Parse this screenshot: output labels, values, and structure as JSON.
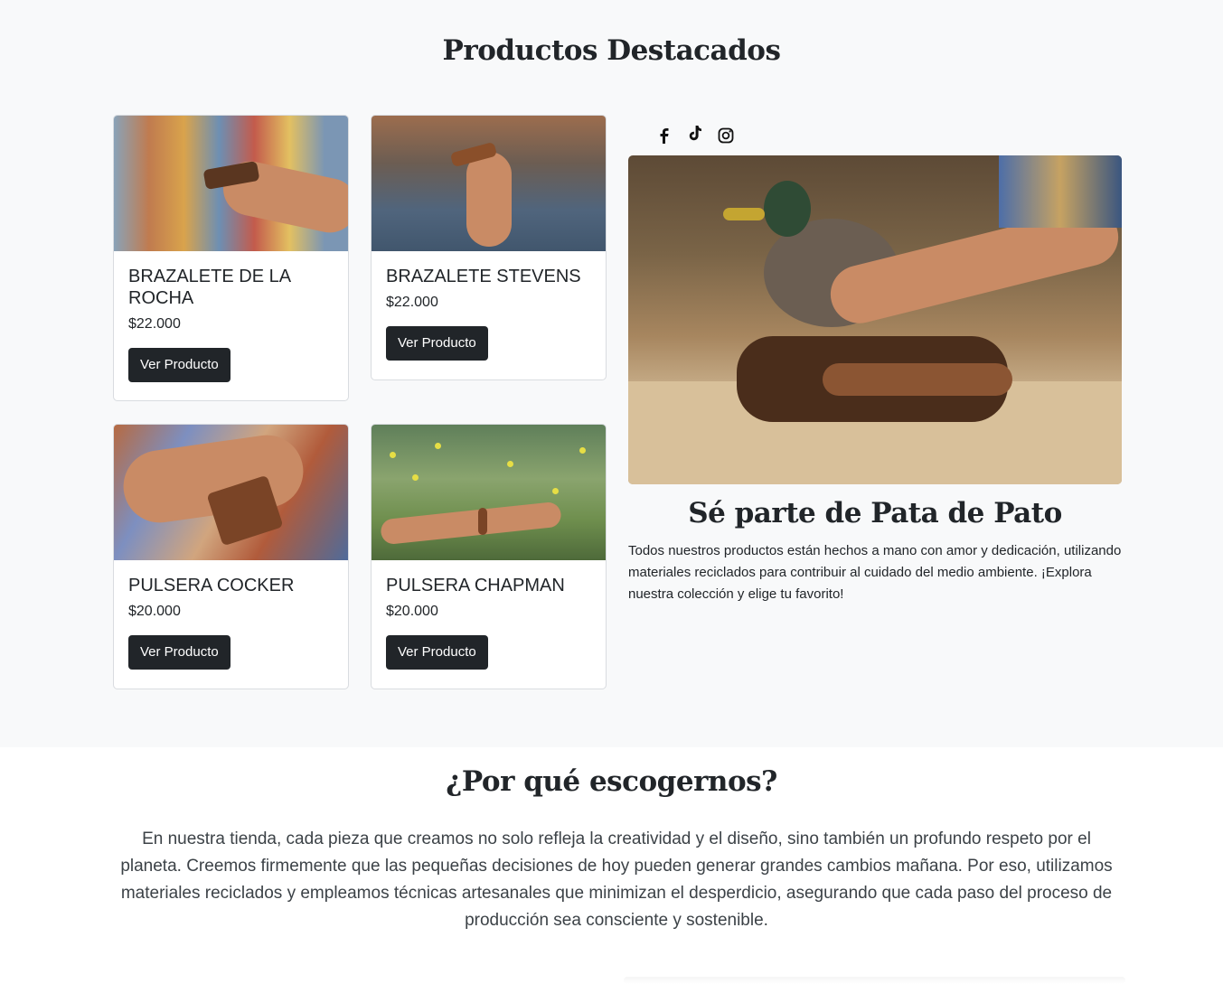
{
  "featured": {
    "title": "Productos Destacados",
    "products": [
      {
        "name": "BRAZALETE DE LA ROCHA",
        "price": "$22.000",
        "button": "Ver Producto"
      },
      {
        "name": "BRAZALETE STEVENS",
        "price": "$22.000",
        "button": "Ver Producto"
      },
      {
        "name": "PULSERA COCKER",
        "price": "$20.000",
        "button": "Ver Producto"
      },
      {
        "name": "PULSERA CHAPMAN",
        "price": "$20.000",
        "button": "Ver Producto"
      }
    ]
  },
  "social": {
    "icons": [
      "facebook-icon",
      "tiktok-icon",
      "instagram-icon"
    ]
  },
  "join": {
    "title": "Sé parte de Pata de Pato",
    "text": "Todos nuestros productos están hechos a mano con amor y dedicación, utilizando materiales reciclados para contribuir al cuidado del medio ambiente. ¡Explora nuestra colección y elige tu favorito!"
  },
  "why": {
    "title": "¿Por qué escogernos?",
    "text": "En nuestra tienda, cada pieza que creamos no solo refleja la creatividad y el diseño, sino también un profundo respeto por el planeta. Creemos firmemente que las pequeñas decisiones de hoy pueden generar grandes cambios mañana. Por eso, utilizamos materiales reciclados y empleamos técnicas artesanales que minimizan el desperdicio, asegurando que cada paso del proceso de producción sea consciente y sostenible."
  },
  "colors": {
    "section_bg": "#f8f9fa",
    "button_bg": "#212529",
    "text": "#212529"
  }
}
